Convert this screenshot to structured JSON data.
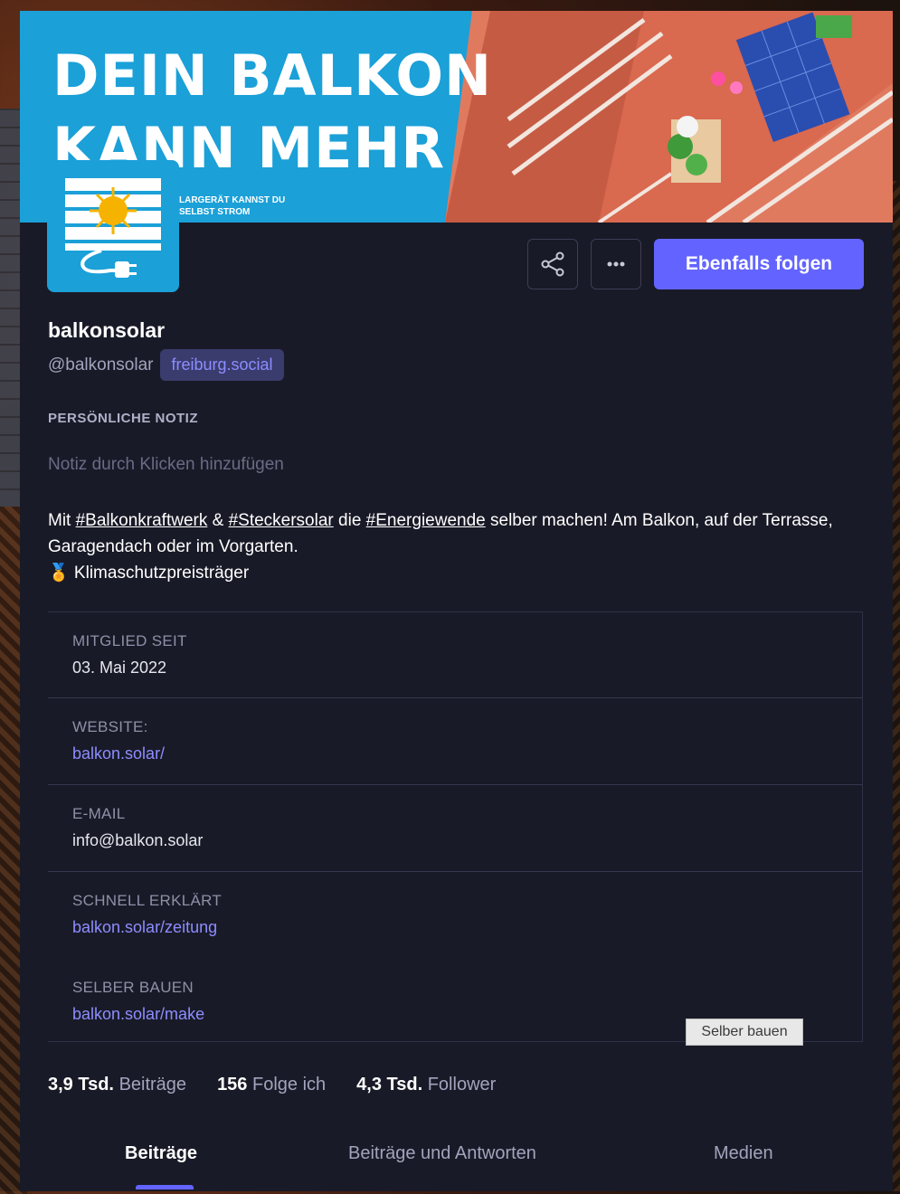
{
  "banner": {
    "title": "DEIN BALKON\nKANN MEHR",
    "subtitle": "LARGERÄT KANNST DU\nSELBST STROM",
    "brand_color": "#1ba0d8"
  },
  "actions": {
    "share_icon": "share-icon",
    "more_icon": "more-horizontal-icon",
    "follow_label": "Ebenfalls folgen",
    "accent_color": "#6364ff"
  },
  "profile": {
    "display_name": "balkonsolar",
    "handle": "@balkonsolar",
    "domain": "freiburg.social"
  },
  "note": {
    "label": "PERSÖNLICHE NOTIZ",
    "placeholder": "Notiz durch Klicken hinzufügen"
  },
  "bio": {
    "p1_mit": "Mit ",
    "tag1": "#Balkonkraftwerk",
    "amp": " & ",
    "tag2": "#Steckersolar",
    "die": " die ",
    "tag3": "#Energiewende",
    "rest": " selber machen! Am Balkon, auf der Terrasse, Garagendach oder im Vorgarten.",
    "line2": "🏅 Klimaschutzpreisträger"
  },
  "fields": [
    {
      "label": "MITGLIED SEIT",
      "value": "03. Mai 2022"
    },
    {
      "label": "WEBSITE:",
      "value": "balkon.solar/"
    },
    {
      "label": "E-MAIL",
      "value": "info@balkon.solar"
    },
    {
      "label": "SCHNELL ERKLÄRT",
      "value": "balkon.solar/zeitung"
    },
    {
      "label": "SELBER BAUEN",
      "value": "balkon.solar/make"
    }
  ],
  "tooltip": "Selber bauen",
  "stats": {
    "posts_num": "3,9 Tsd.",
    "posts_label": "Beiträge",
    "following_num": "156",
    "following_label": "Folge ich",
    "followers_num": "4,3 Tsd.",
    "followers_label": "Follower"
  },
  "tabs": [
    {
      "label": "Beiträge"
    },
    {
      "label": "Beiträge und Antworten"
    },
    {
      "label": "Medien"
    }
  ]
}
